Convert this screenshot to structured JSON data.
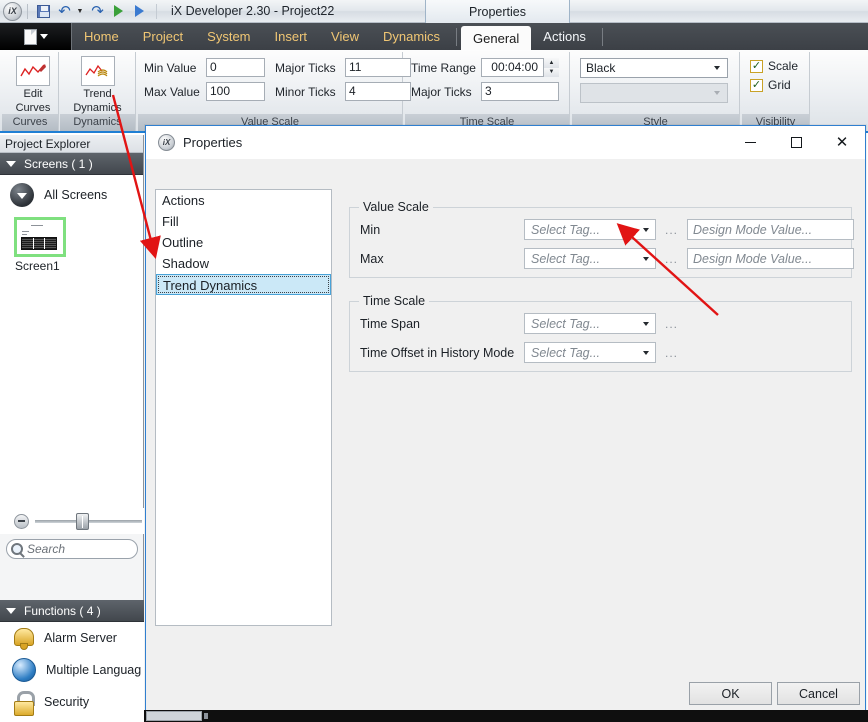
{
  "titlebar": {
    "app_title": "iX Developer 2.30 - Project22",
    "orb_label": "iX",
    "quick_access": [
      {
        "name": "save-icon",
        "label": "Save"
      },
      {
        "name": "undo-icon",
        "label": "Undo"
      },
      {
        "name": "undo-dropdown-icon",
        "label": "Undo history"
      },
      {
        "name": "redo-icon",
        "label": "Redo"
      },
      {
        "name": "run-icon",
        "label": "Run"
      },
      {
        "name": "run-simulate-icon",
        "label": "Simulate"
      }
    ]
  },
  "ribbon": {
    "app_menu_label": "File",
    "tabs": [
      {
        "label": "Home",
        "active": false
      },
      {
        "label": "Project",
        "active": false
      },
      {
        "label": "System",
        "active": false
      },
      {
        "label": "Insert",
        "active": false
      },
      {
        "label": "View",
        "active": false
      },
      {
        "label": "Dynamics",
        "active": false
      }
    ],
    "contextual_header": "Properties",
    "contextual_tabs": [
      {
        "label": "General",
        "active": true
      },
      {
        "label": "Actions",
        "active": false
      }
    ],
    "groups": {
      "curves": {
        "label": "Curves",
        "button_line1": "Edit",
        "button_line2": "Curves"
      },
      "dynamics": {
        "label": "Dynamics",
        "button_line1": "Trend",
        "button_line2": "Dynamics"
      },
      "value_scale": {
        "label": "Value Scale",
        "min_value_label": "Min Value",
        "min_value": "0",
        "max_value_label": "Max Value",
        "max_value": "100",
        "major_ticks_label": "Major Ticks",
        "major_ticks": "11",
        "minor_ticks_label": "Minor Ticks",
        "minor_ticks": "4"
      },
      "time_scale": {
        "label": "Time Scale",
        "time_range_label": "Time Range",
        "time_range": "00:04:00",
        "major_ticks_label": "Major Ticks",
        "major_ticks": "3"
      },
      "style": {
        "label": "Style",
        "color": "Black",
        "secondary": ""
      },
      "visibility": {
        "label": "Visibility",
        "scale_label": "Scale",
        "scale_checked": "✓",
        "grid_label": "Grid",
        "grid_checked": "✓"
      }
    }
  },
  "project_explorer": {
    "title": "Project Explorer",
    "screens_section": {
      "header": "Screens ( 1 )",
      "all_screens_label": "All Screens",
      "screen_name": "Screen1"
    },
    "search_placeholder": "Search",
    "functions_section": {
      "header": "Functions ( 4 )",
      "items": [
        {
          "label": "Alarm Server",
          "icon": "bell-icon"
        },
        {
          "label": "Multiple Languag",
          "icon": "globe-icon"
        },
        {
          "label": "Security",
          "icon": "lock-icon"
        }
      ]
    }
  },
  "dialog": {
    "title": "Properties",
    "icon_label": "iX",
    "window_buttons": {
      "minimize": "—",
      "maximize": "□",
      "close": "✕"
    },
    "nav_items": [
      {
        "label": "Actions",
        "selected": false
      },
      {
        "label": "Fill",
        "selected": false
      },
      {
        "label": "Outline",
        "selected": false
      },
      {
        "label": "Shadow",
        "selected": false
      },
      {
        "label": "Trend Dynamics",
        "selected": true
      }
    ],
    "value_scale": {
      "group_label": "Value Scale",
      "rows": [
        {
          "label": "Min",
          "tag": "Select Tag...",
          "ellipsis": "...",
          "design_value": "Design Mode Value..."
        },
        {
          "label": "Max",
          "tag": "Select Tag...",
          "ellipsis": "...",
          "design_value": "Design Mode Value..."
        }
      ]
    },
    "time_scale": {
      "group_label": "Time Scale",
      "rows": [
        {
          "label": "Time Span",
          "tag": "Select Tag...",
          "ellipsis": "..."
        },
        {
          "label": "Time Offset in History Mode",
          "tag": "Select Tag...",
          "ellipsis": "..."
        }
      ]
    },
    "footer": {
      "ok_label": "OK",
      "cancel_label": "Cancel"
    }
  },
  "annotations": {
    "arrow_color": "#e11414",
    "arrow_1_target": "Trend Dynamics nav item",
    "arrow_2_target": "Max Select Tag dropdown"
  },
  "colors": {
    "accent_blue": "#1f7fd4",
    "ribbon_tab_text": "#f0c674",
    "selection_blue": "#cbe8f7",
    "thumbnail_border_green": "#7fe07f"
  }
}
